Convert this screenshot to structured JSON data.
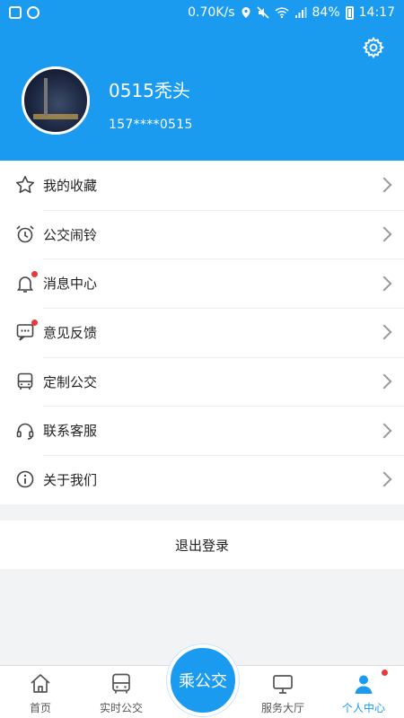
{
  "status": {
    "speed": "0.70K/s",
    "battery": "84%",
    "time": "14:17"
  },
  "profile": {
    "name": "0515秃头",
    "phone": "157****0515"
  },
  "menu": [
    {
      "label": "我的收藏",
      "icon": "star-icon",
      "dot": false
    },
    {
      "label": "公交闹铃",
      "icon": "alarm-clock-icon",
      "dot": false
    },
    {
      "label": "消息中心",
      "icon": "bell-icon",
      "dot": true
    },
    {
      "label": "意见反馈",
      "icon": "feedback-icon",
      "dot": true
    },
    {
      "label": "定制公交",
      "icon": "bus-icon",
      "dot": false
    },
    {
      "label": "联系客服",
      "icon": "headset-icon",
      "dot": false
    },
    {
      "label": "关于我们",
      "icon": "info-icon",
      "dot": false
    }
  ],
  "logout_label": "退出登录",
  "tabs": [
    {
      "label": "首页",
      "icon": "home-icon"
    },
    {
      "label": "实时公交",
      "icon": "bus-icon"
    },
    {
      "label": "服务大厅",
      "icon": "monitor-icon"
    },
    {
      "label": "个人中心",
      "icon": "user-icon",
      "active": true
    }
  ],
  "center_button": "乘公交",
  "colors": {
    "primary": "#1a9bf0",
    "badge": "#e53b3b"
  }
}
